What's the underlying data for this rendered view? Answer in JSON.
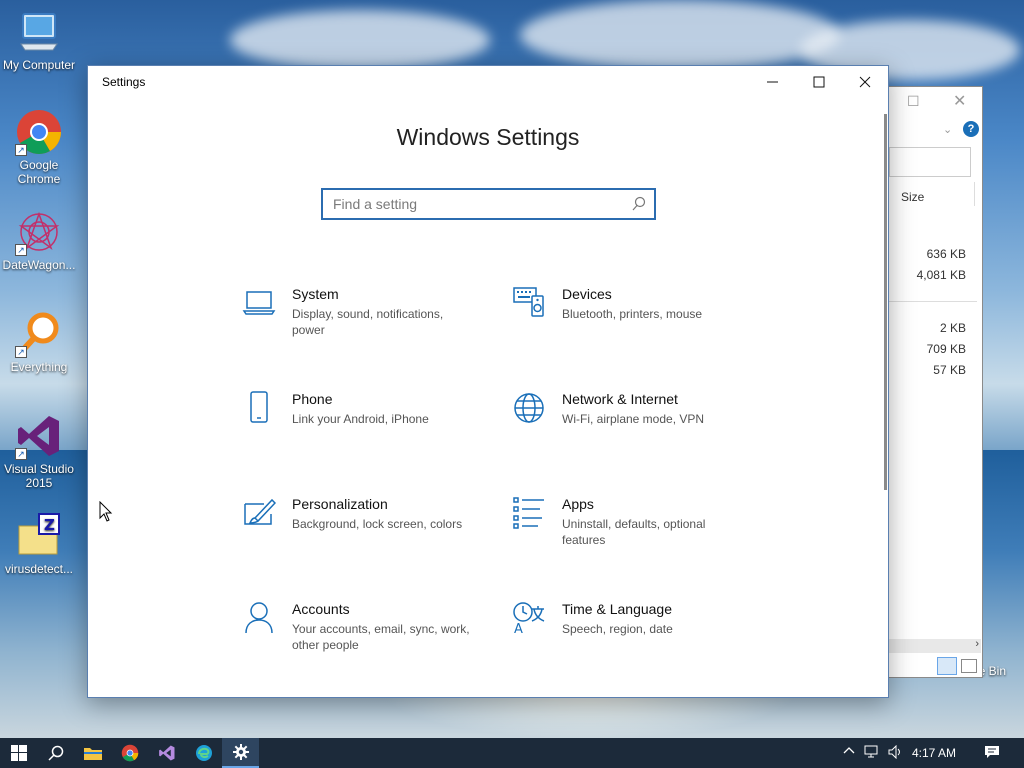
{
  "desktop": {
    "icons": [
      {
        "label": "My Computer",
        "icon": "computer-icon"
      },
      {
        "label": "Google Chrome",
        "icon": "chrome-icon"
      },
      {
        "label": "DateWagon...",
        "icon": "datewagon-icon"
      },
      {
        "label": "Everything",
        "icon": "search-magnifier-icon"
      },
      {
        "label": "Visual Studio 2015",
        "icon": "visual-studio-icon"
      },
      {
        "label": "virusdetect...",
        "icon": "archive-icon"
      }
    ],
    "recycle_bin_partial": "e Bin"
  },
  "explorer": {
    "column_header": "Size",
    "sizes": [
      "636 KB",
      "4,081 KB",
      "2 KB",
      "709 KB",
      "57 KB"
    ]
  },
  "settings": {
    "window_title": "Settings",
    "heading": "Windows Settings",
    "search_placeholder": "Find a setting",
    "tiles": [
      {
        "name": "System",
        "desc": "Display, sound, notifications, power",
        "icon": "laptop-icon"
      },
      {
        "name": "Devices",
        "desc": "Bluetooth, printers, mouse",
        "icon": "keyboard-speaker-icon"
      },
      {
        "name": "Phone",
        "desc": "Link your Android, iPhone",
        "icon": "phone-icon"
      },
      {
        "name": "Network & Internet",
        "desc": "Wi-Fi, airplane mode, VPN",
        "icon": "globe-icon"
      },
      {
        "name": "Personalization",
        "desc": "Background, lock screen, colors",
        "icon": "paint-brush-icon"
      },
      {
        "name": "Apps",
        "desc": "Uninstall, defaults, optional features",
        "icon": "apps-list-icon"
      },
      {
        "name": "Accounts",
        "desc": "Your accounts, email, sync, work, other people",
        "icon": "person-icon"
      },
      {
        "name": "Time & Language",
        "desc": "Speech, region, date",
        "icon": "time-language-icon"
      }
    ]
  },
  "taskbar": {
    "clock": "4:17 AM",
    "pinned": [
      "start-icon",
      "search-icon",
      "file-explorer-icon",
      "chrome-icon",
      "visual-studio-icon",
      "edge-icon",
      "settings-gear-icon"
    ]
  },
  "colors": {
    "accent": "#0067b8",
    "icon_blue": "#1a6fb8",
    "taskbar": "#1c2a3a"
  }
}
